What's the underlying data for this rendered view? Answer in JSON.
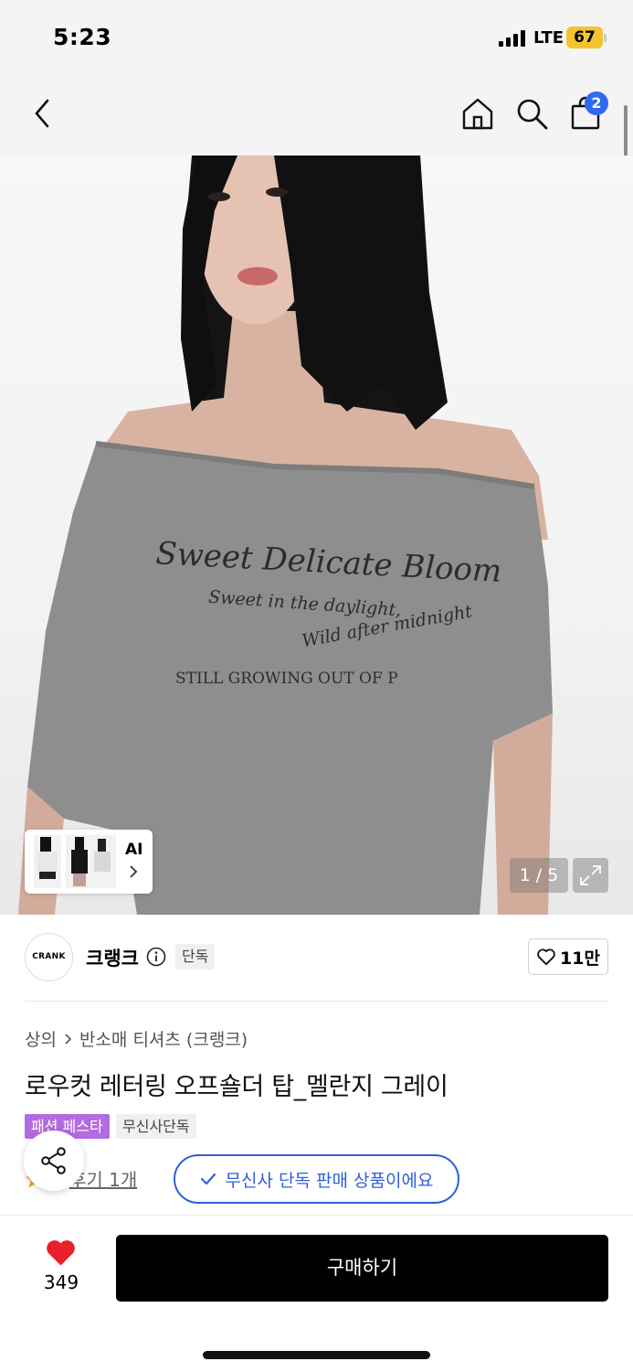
{
  "status_bar": {
    "time": "5:23",
    "network": "LTE",
    "battery": "67"
  },
  "nav": {
    "cart_count": "2",
    "icons": [
      "back-icon",
      "home-icon",
      "search-icon",
      "cart-icon"
    ]
  },
  "gallery": {
    "ai_label": "AI",
    "counter": "1 / 5",
    "print_text": {
      "line1": "Sweet Delicate Bloom",
      "line2": "Sweet in the daylight,",
      "line3": "Wild after midnight",
      "line4": "STILL GROWING OUT OF P"
    }
  },
  "brand": {
    "logo_text": "CRANK",
    "name": "크랭크",
    "exclusive_chip": "단독",
    "like_count": "11만"
  },
  "product": {
    "breadcrumb": [
      "상의",
      "반소매 티셔츠 (크랭크)"
    ],
    "title": "로우컷 레터링 오프숄더 탑_멜란지 그레이",
    "tags": [
      "패션 페스타",
      "무신사단독"
    ],
    "review_link": "후기 1개",
    "exclusive_notice": "무신사 단독 판매 상품이에요"
  },
  "bottom_bar": {
    "heart_count": "349",
    "buy_label": "구매하기"
  },
  "colors": {
    "accent_blue": "#2f5fd8",
    "festa_purple": "#b36be0",
    "heart_red": "#e8202a",
    "battery_yellow": "#f4c430"
  }
}
